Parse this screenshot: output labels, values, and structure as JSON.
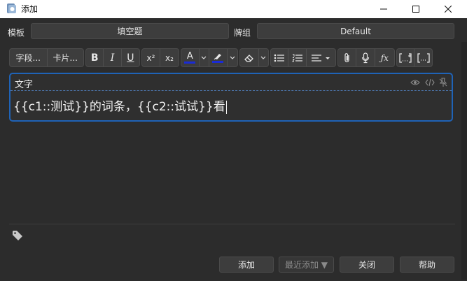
{
  "window": {
    "title": "添加"
  },
  "header": {
    "notetype_label": "模板",
    "notetype_value": "填空题",
    "deck_label": "牌组",
    "deck_value": "Default"
  },
  "toolbar": {
    "fields_label": "字段...",
    "cards_label": "卡片...",
    "bold": "B",
    "italic": "I",
    "underline": "U",
    "superscript": "x²",
    "subscript": "x₂",
    "text_color": "A",
    "text_color_hex": "#1a2bd6",
    "highlight_hex": "#1a2bd6"
  },
  "editor": {
    "field_name": "文字",
    "field_content": "{{c1::测试}}的词条，{{c2::试试}}看"
  },
  "buttons": {
    "add": "添加",
    "history": "最近添加 ▼",
    "close": "关闭",
    "help": "帮助"
  },
  "colors": {
    "background": "#2c2c2c",
    "button": "#3d3d3d",
    "focus_border": "#1f63b7"
  }
}
